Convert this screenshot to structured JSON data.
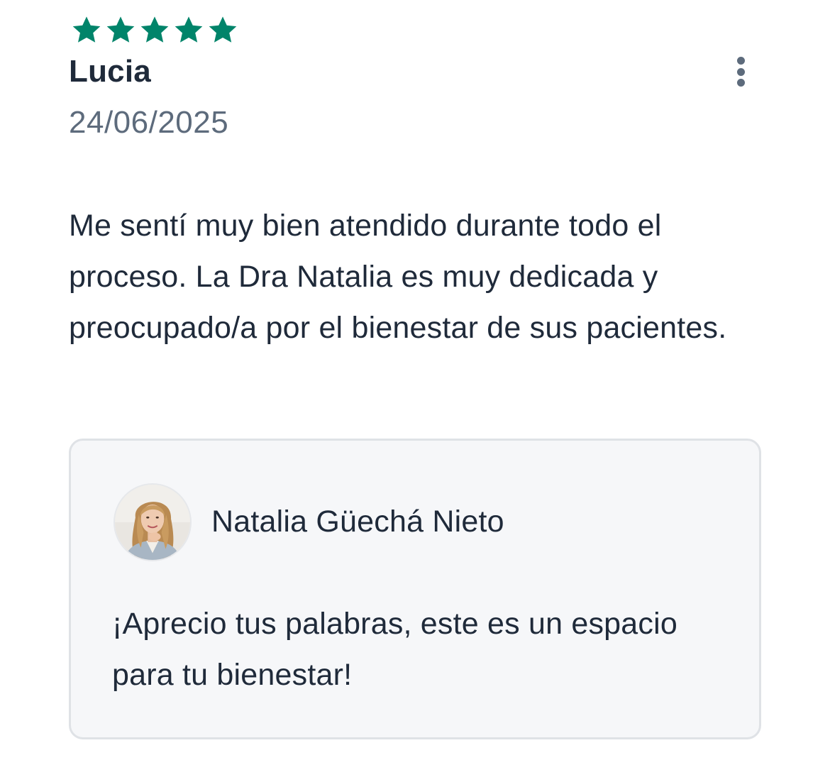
{
  "review": {
    "rating": 5,
    "rating_max": 5,
    "star_color": "#00846a",
    "stars": [
      "star-icon",
      "star-icon",
      "star-icon",
      "star-icon",
      "star-icon"
    ],
    "author": "Lucia",
    "date": "24/06/2025",
    "text": "Me sentí muy bien atendido durante todo el proceso. La Dra Natalia es muy dedicada y preocupado/a por el bienestar de sus pacientes.",
    "more_icon": "more-vertical-icon"
  },
  "reply": {
    "author": "Natalia Güechá Nieto",
    "avatar_icon": "profile-photo",
    "text": "¡Aprecio tus palabras, este es un espacio para tu bienestar!"
  }
}
